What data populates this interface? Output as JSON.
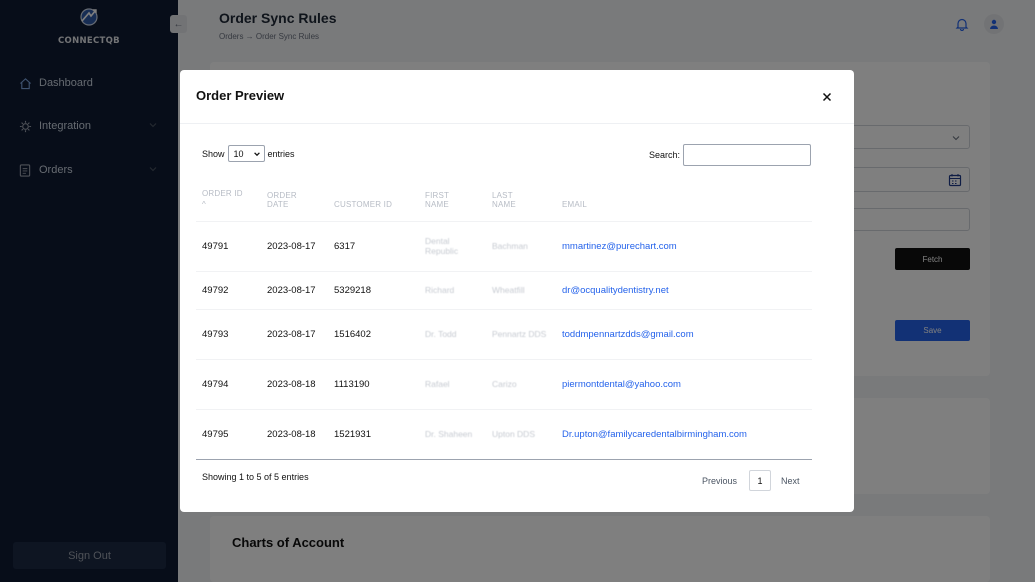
{
  "app": {
    "brand": "CONNECTQB",
    "page_title": "Order Sync Rules",
    "breadcrumb": "Orders → Order Sync Rules"
  },
  "sidebar": {
    "items": [
      {
        "label": "Dashboard",
        "icon": "home-icon"
      },
      {
        "label": "Integration",
        "icon": "integration-icon"
      },
      {
        "label": "Orders",
        "icon": "document-icon"
      }
    ],
    "sign_out": "Sign Out"
  },
  "background": {
    "fetch_label": "Fetch",
    "save_label": "Save",
    "charts_title": "Charts of Account"
  },
  "modal": {
    "title": "Order Preview",
    "show_label": "Show",
    "entries_value": "10",
    "entries_label": "entries",
    "search_label": "Search:",
    "search_value": "",
    "columns": [
      {
        "line1": "ORDER ID",
        "line2": ""
      },
      {
        "line1": "ORDER",
        "line2": "DATE"
      },
      {
        "line1": "CUSTOMER ID",
        "line2": ""
      },
      {
        "line1": "FIRST",
        "line2": "NAME"
      },
      {
        "line1": "LAST",
        "line2": "NAME"
      },
      {
        "line1": "EMAIL",
        "line2": ""
      }
    ],
    "rows": [
      {
        "order_id": "49791",
        "date": "2023-08-17",
        "customer_id": "6317",
        "first": "Dental Republic",
        "last": "Bachman",
        "email": "mmartinez@purechart.com"
      },
      {
        "order_id": "49792",
        "date": "2023-08-17",
        "customer_id": "5329218",
        "first": "Richard",
        "last": "Wheatfill",
        "email": "dr@ocqualitydentistry.net"
      },
      {
        "order_id": "49793",
        "date": "2023-08-17",
        "customer_id": "1516402",
        "first": "Dr. Todd",
        "last": "Pennartz DDS",
        "email": "toddmpennartzdds@gmail.com"
      },
      {
        "order_id": "49794",
        "date": "2023-08-18",
        "customer_id": "1113190",
        "first": "Rafael",
        "last": "Carizo",
        "email": "piermontdental@yahoo.com"
      },
      {
        "order_id": "49795",
        "date": "2023-08-18",
        "customer_id": "1521931",
        "first": "Dr. Shaheen",
        "last": "Upton DDS",
        "email": "Dr.upton@familycaredentalbirmingham.com"
      }
    ],
    "info": "Showing 1 to 5 of 5 entries",
    "previous": "Previous",
    "current_page": "1",
    "next": "Next"
  },
  "colors": {
    "sidebar_bg": "#0f1a33",
    "accent": "#2563eb",
    "overlay": "rgba(0,0,0,0.5)"
  }
}
